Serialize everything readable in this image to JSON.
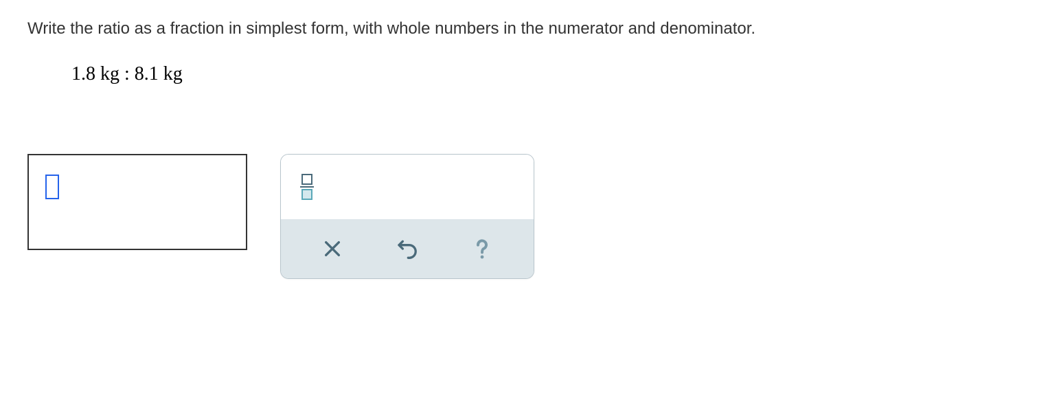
{
  "question": {
    "prompt": "Write the ratio as a fraction in simplest form, with whole numbers in the numerator and denominator.",
    "expression": "1.8 kg : 8.1 kg"
  },
  "answer": {
    "value": ""
  },
  "toolbar": {
    "fraction_button": "fraction",
    "clear_button": "clear",
    "undo_button": "undo",
    "help_button": "help"
  }
}
